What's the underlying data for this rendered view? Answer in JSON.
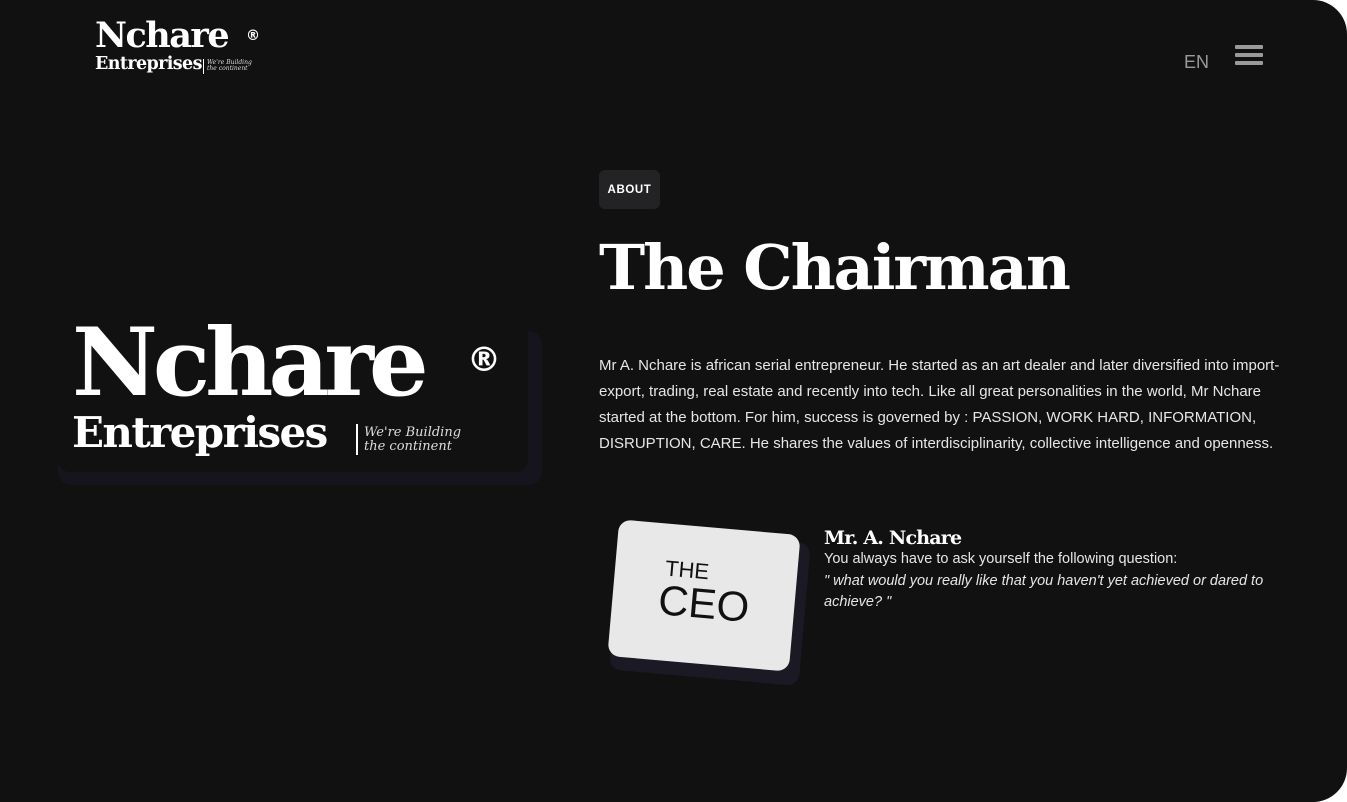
{
  "header": {
    "logo": {
      "name": "Nchare",
      "reg": "®",
      "sub": "Entreprises",
      "tagline": "We're Building the continent"
    },
    "lang": "EN",
    "menu_icon": "hamburger-menu-icon"
  },
  "hero_logo": {
    "name": "Nchare",
    "reg": "®",
    "sub": "Entreprises",
    "tagline_line1": "We're Building",
    "tagline_line2": "the continent"
  },
  "about": {
    "badge": "ABOUT",
    "title": "The Chairman",
    "body": "Mr A. Nchare is african serial entrepreneur.  He started as an art dealer and later diversified into import-export, trading, real estate and recently into tech. Like all great personalities in the world, Mr Nchare started at the bottom. For him,  success is governed by : PASSION, WORK HARD, INFORMATION, DISRUPTION, CARE. He shares the values of interdisciplinarity, collective intelligence and openness."
  },
  "ceo_card": {
    "line1": "THE",
    "line2": "CEO"
  },
  "ceo": {
    "name": "Mr. A. Nchare",
    "line": "You always have to ask yourself the following question:",
    "quote": "\" what would you really like that you haven't yet achieved or dared to achieve? \""
  },
  "colors": {
    "background": "#111112",
    "text": "#ffffff",
    "muted": "#9a9a9a",
    "badge": "#232325",
    "card": "#e8e8e8"
  }
}
